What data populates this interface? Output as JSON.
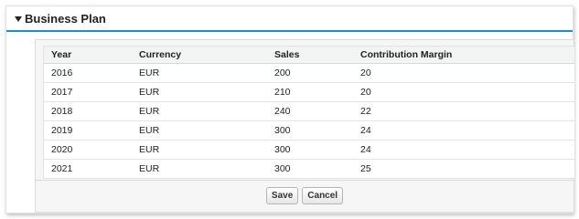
{
  "section": {
    "title": "Business Plan",
    "toggle_icon": "triangle-down-icon",
    "accent_color": "#1f8dd6"
  },
  "table": {
    "columns": [
      "Year",
      "Currency",
      "Sales",
      "Contribution Margin"
    ],
    "rows": [
      [
        "2016",
        "EUR",
        "200",
        "20"
      ],
      [
        "2017",
        "EUR",
        "210",
        "20"
      ],
      [
        "2018",
        "EUR",
        "240",
        "22"
      ],
      [
        "2019",
        "EUR",
        "300",
        "24"
      ],
      [
        "2020",
        "EUR",
        "300",
        "24"
      ],
      [
        "2021",
        "EUR",
        "300",
        "25"
      ]
    ]
  },
  "buttons": {
    "save_label": "Save",
    "cancel_label": "Cancel"
  }
}
